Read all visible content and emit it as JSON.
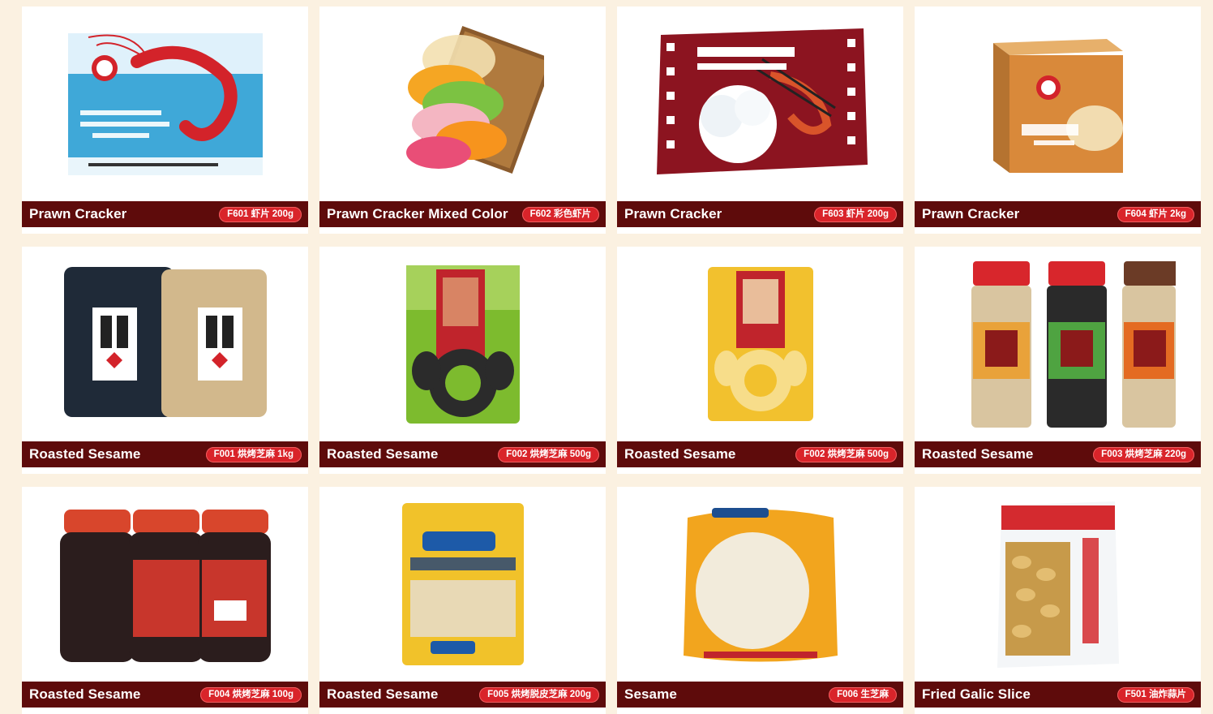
{
  "colors": {
    "page_background": "#fbf1e1",
    "caption_bar": "#5e0b0b",
    "code_badge": "#d9242a"
  },
  "products": [
    {
      "name": "Prawn Cracker",
      "code": "F601 虾片 200g",
      "icon": "prawn-cracker-box-icon"
    },
    {
      "name": "Prawn Cracker Mixed Color",
      "code": "F602 彩色虾片",
      "icon": "mixed-color-crackers-icon"
    },
    {
      "name": "Prawn Cracker",
      "code": "F603 虾片 200g",
      "icon": "jessys-beignets-box-icon"
    },
    {
      "name": "Prawn Cracker",
      "code": "F604 虾片 2kg",
      "icon": "prawn-cracker-carton-icon"
    },
    {
      "name": "Roasted Sesame",
      "code": "F001 烘烤芝麻 1kg",
      "icon": "sesame-bags-icon"
    },
    {
      "name": "Roasted Sesame",
      "code": "F002 烘烤芝麻 500g",
      "icon": "black-sesame-pouch-icon"
    },
    {
      "name": "Roasted Sesame",
      "code": "F002 烘烤芝麻 500g",
      "icon": "white-sesame-pouch-icon"
    },
    {
      "name": "Roasted Sesame",
      "code": "F003 烘烤芝麻 220g",
      "icon": "sesame-jars-icon"
    },
    {
      "name": "Roasted Sesame",
      "code": "F004 烘烤芝麻 100g",
      "icon": "black-sesame-jars-icon"
    },
    {
      "name": "Roasted Sesame",
      "code": "F005 烘烤脱皮芝麻 200g",
      "icon": "hulled-sesame-bag-icon"
    },
    {
      "name": "Sesame",
      "code": "F006 生芝麻",
      "icon": "raw-sesame-sack-icon"
    },
    {
      "name": "Fried Galic Slice",
      "code": "F501 油炸蒜片",
      "icon": "fried-garlic-bag-icon"
    }
  ]
}
